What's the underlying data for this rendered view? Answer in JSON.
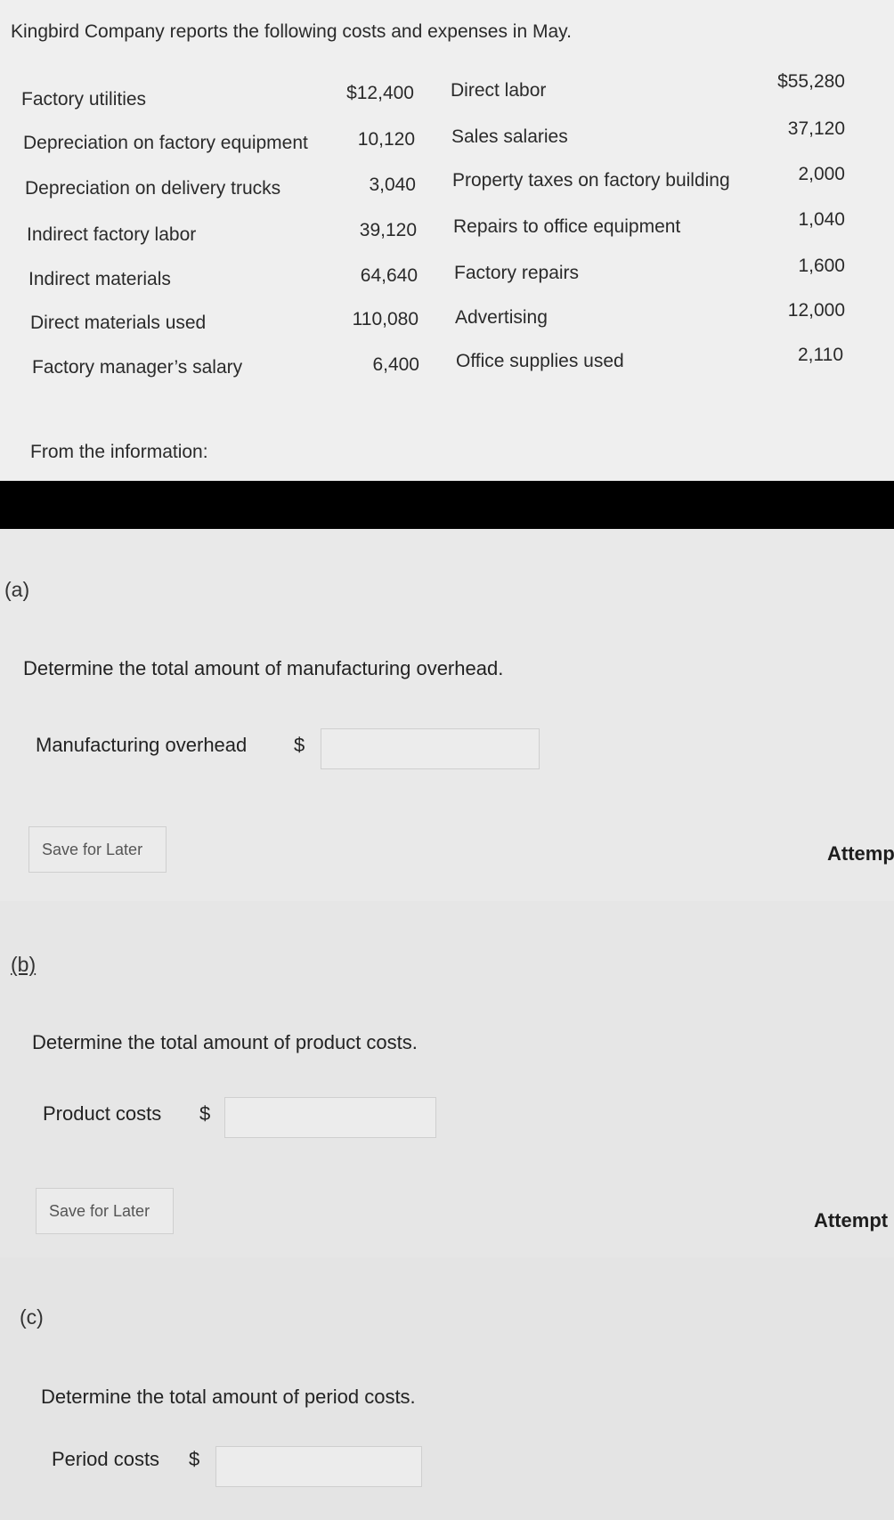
{
  "intro": "Kingbird Company reports the following costs and expenses in May.",
  "costs_left": [
    {
      "name": "Factory utilities",
      "value": "$12,400"
    },
    {
      "name": "Depreciation on factory equipment",
      "value": "10,120"
    },
    {
      "name": "Depreciation on delivery trucks",
      "value": "3,040"
    },
    {
      "name": "Indirect factory labor",
      "value": "39,120"
    },
    {
      "name": "Indirect materials",
      "value": "64,640"
    },
    {
      "name": "Direct materials used",
      "value": "110,080"
    },
    {
      "name": "Factory manager’s salary",
      "value": "6,400"
    }
  ],
  "costs_right": [
    {
      "name": "Direct labor",
      "value": "$55,280"
    },
    {
      "name": "Sales salaries",
      "value": "37,120"
    },
    {
      "name": "Property taxes on factory building",
      "value": "2,000"
    },
    {
      "name": "Repairs to office equipment",
      "value": "1,040"
    },
    {
      "name": "Factory repairs",
      "value": "1,600"
    },
    {
      "name": "Advertising",
      "value": "12,000"
    },
    {
      "name": "Office supplies used",
      "value": "2,110"
    }
  ],
  "from_info": "From the information:",
  "part_a": {
    "label": "(a)",
    "question": "Determine the total amount of manufacturing overhead.",
    "field_label": "Manufacturing overhead",
    "currency": "$",
    "value": "",
    "save_label": "Save for Later",
    "attempts": "Attemp"
  },
  "part_b": {
    "label": "(b)",
    "question": "Determine the total amount of product costs.",
    "field_label": "Product costs",
    "currency": "$",
    "value": "",
    "save_label": "Save for Later",
    "attempts": "Attempt"
  },
  "part_c": {
    "label": "(c)",
    "question": "Determine the total amount of period costs.",
    "field_label": "Period costs",
    "currency": "$",
    "value": ""
  }
}
